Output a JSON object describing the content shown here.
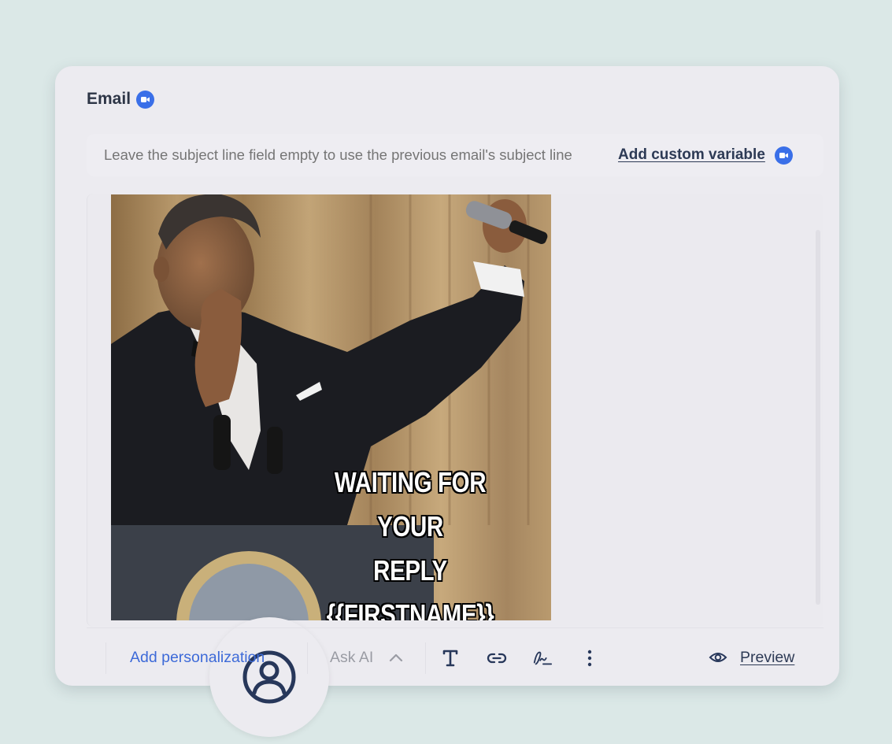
{
  "card": {
    "title": "Email"
  },
  "subject": {
    "placeholder": "Leave the subject line field empty to use the previous email's subject line",
    "add_custom_variable_label": "Add custom variable"
  },
  "editor": {
    "meme_caption_line1": "WAITING FOR YOUR",
    "meme_caption_line2": "REPLY",
    "meme_caption_line3": "{{FIRSTNAME}}"
  },
  "toolbar": {
    "add_personalization_label": "Add personalization",
    "ask_ai_label": "Ask AI",
    "preview_label": "Preview",
    "icons": [
      "text-format-icon",
      "link-icon",
      "signature-icon",
      "more-vertical-icon",
      "eye-icon"
    ]
  },
  "colors": {
    "background": "#dbe8e7",
    "card": "#ecebf0",
    "accent_blue": "#3a6fe8",
    "dark_text": "#2d3546",
    "muted_text": "#8a8d96"
  }
}
